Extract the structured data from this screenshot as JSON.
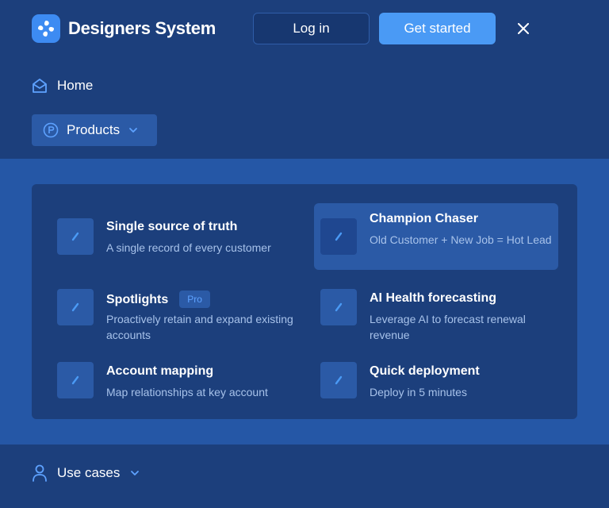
{
  "header": {
    "brand": "Designers System",
    "login_label": "Log in",
    "cta_label": "Get started",
    "icons": {
      "logo": "swirl-logo-icon",
      "close": "close-icon"
    }
  },
  "nav": {
    "home_label": "Home",
    "products_label": "Products",
    "use_cases_label": "Use cases"
  },
  "products": {
    "items": [
      {
        "title": "Single source of truth",
        "desc": "A single record of every customer",
        "badge": ""
      },
      {
        "title": "Champion Chaser",
        "desc": "Old Customer + New Job = Hot Lead",
        "badge": "",
        "active": true
      },
      {
        "title": "Spotlights",
        "desc": "Proactively retain and expand existing accounts",
        "badge": "Pro"
      },
      {
        "title": "AI Health forecasting",
        "desc": "Leverage AI to forecast renewal revenue",
        "badge": ""
      },
      {
        "title": "Account mapping",
        "desc": "Map relationships at key account",
        "badge": ""
      },
      {
        "title": "Quick deployment",
        "desc": "Deploy in 5 minutes",
        "badge": ""
      }
    ]
  },
  "colors": {
    "background": "#1c3f7c",
    "band": "#2557a6",
    "accent": "#4a9af5",
    "muted_text": "#a7c2ea"
  }
}
